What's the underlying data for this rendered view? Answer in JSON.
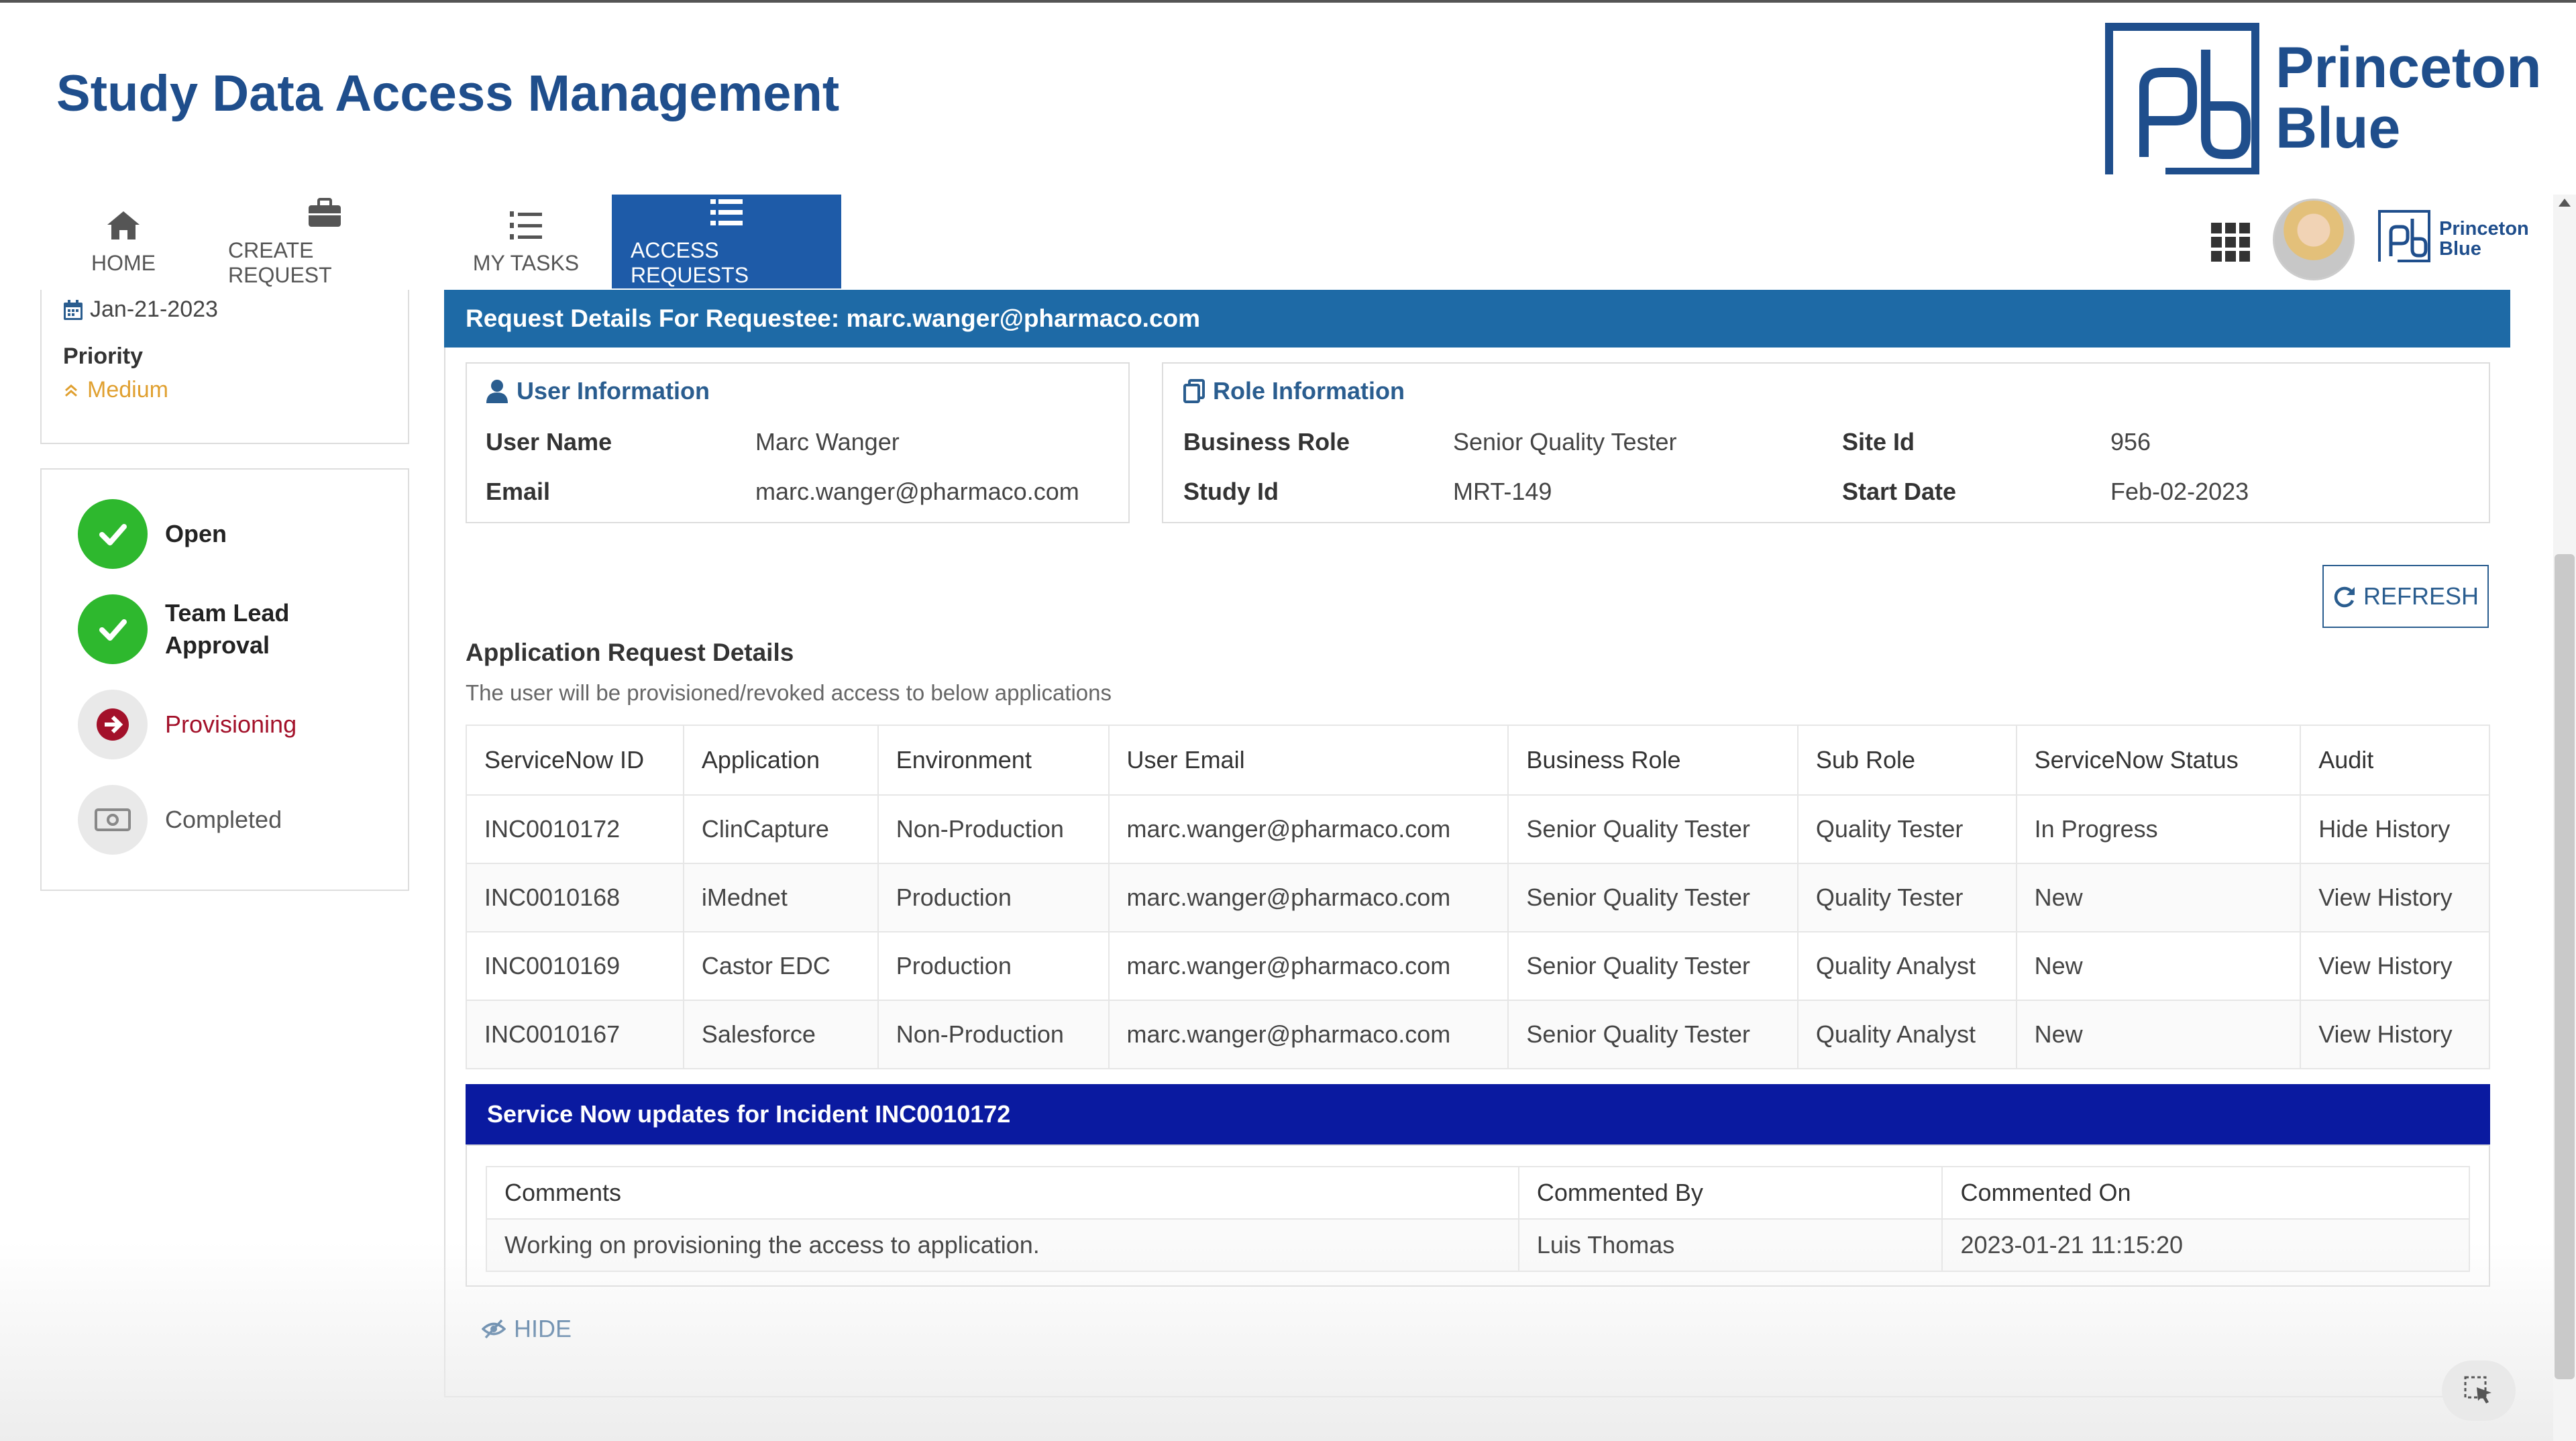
{
  "header": {
    "title": "Study Data Access Management",
    "brand_name_line1": "Princeton",
    "brand_name_line2": "Blue",
    "mini_brand_line1": "Princeton",
    "mini_brand_line2": "Blue"
  },
  "nav": {
    "tabs": [
      {
        "label": "HOME",
        "icon": "home-icon"
      },
      {
        "label": "CREATE REQUEST",
        "icon": "briefcase-icon"
      },
      {
        "label": "MY TASKS",
        "icon": "task-list-icon"
      },
      {
        "label": "ACCESS REQUESTS",
        "icon": "list-icon",
        "active": true
      }
    ]
  },
  "sidebar": {
    "date": "Jan-21-2023",
    "priority_label": "Priority",
    "priority_value": "Medium",
    "steps": [
      {
        "label": "Open",
        "state": "done"
      },
      {
        "label": "Team Lead Approval",
        "state": "done"
      },
      {
        "label": "Provisioning",
        "state": "current"
      },
      {
        "label": "Completed",
        "state": "pending"
      }
    ]
  },
  "request": {
    "header": "Request Details For Requestee: marc.wanger@pharmaco.com",
    "user_info": {
      "title": "User Information",
      "user_name_label": "User Name",
      "user_name": "Marc Wanger",
      "email_label": "Email",
      "email": "marc.wanger@pharmaco.com"
    },
    "role_info": {
      "title": "Role Information",
      "business_role_label": "Business Role",
      "business_role": "Senior Quality Tester",
      "study_id_label": "Study Id",
      "study_id": "MRT-149",
      "site_id_label": "Site Id",
      "site_id": "956",
      "start_date_label": "Start Date",
      "start_date": "Feb-02-2023"
    },
    "refresh_label": "REFRESH"
  },
  "applications": {
    "title": "Application Request Details",
    "subtitle": "The user will be provisioned/revoked access to below applications",
    "columns": [
      "ServiceNow ID",
      "Application",
      "Environment",
      "User Email",
      "Business Role",
      "Sub Role",
      "ServiceNow Status",
      "Audit"
    ],
    "rows": [
      {
        "id": "INC0010172",
        "application": "ClinCapture",
        "environment": "Non-Production",
        "email": "marc.wanger@pharmaco.com",
        "role": "Senior Quality Tester",
        "sub_role": "Quality Tester",
        "status": "In Progress",
        "audit": "Hide History"
      },
      {
        "id": "INC0010168",
        "application": "iMednet",
        "environment": "Production",
        "email": "marc.wanger@pharmaco.com",
        "role": "Senior Quality Tester",
        "sub_role": "Quality Tester",
        "status": "New",
        "audit": "View History"
      },
      {
        "id": "INC0010169",
        "application": "Castor EDC",
        "environment": "Production",
        "email": "marc.wanger@pharmaco.com",
        "role": "Senior Quality Tester",
        "sub_role": "Quality Analyst",
        "status": "New",
        "audit": "View History"
      },
      {
        "id": "INC0010167",
        "application": "Salesforce",
        "environment": "Non-Production",
        "email": "marc.wanger@pharmaco.com",
        "role": "Senior Quality Tester",
        "sub_role": "Quality Analyst",
        "status": "New",
        "audit": "View History"
      }
    ]
  },
  "servicenow": {
    "title": "Service Now updates for Incident INC0010172",
    "columns": [
      "Comments",
      "Commented By",
      "Commented On"
    ],
    "rows": [
      {
        "comment": "Working on provisioning the access to application.",
        "by": "Luis Thomas",
        "on": "2023-01-21 11:15:20"
      }
    ],
    "hide_label": "HIDE"
  },
  "colors": {
    "brand": "#1f4e8c",
    "active_tab": "#1e5ba8",
    "request_header": "#1e6aa6",
    "servicenow_bar": "#0a1aa0",
    "done_green": "#2eb82e",
    "current_red": "#a3112a",
    "in_progress": "#e0a030"
  }
}
